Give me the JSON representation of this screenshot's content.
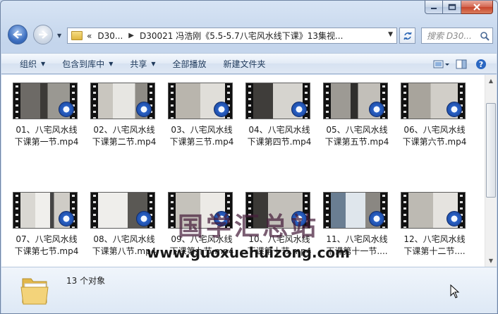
{
  "window": {
    "accent": "#c4d5ec"
  },
  "address": {
    "chevron": "«",
    "crumbs": [
      "D30...",
      "D30021 冯浩刚《5.5-5.7八宅风水线下课》13集视..."
    ]
  },
  "search": {
    "placeholder": "搜索 D30..."
  },
  "toolbar": {
    "organize": "组织",
    "include_library": "包含到库中",
    "share": "共享",
    "play_all": "全部播放",
    "new_folder": "新建文件夹"
  },
  "files": [
    {
      "line1": "01、八宅风水线",
      "line2": "下课第一节.mp4"
    },
    {
      "line1": "02、八宅风水线",
      "line2": "下课第二节.mp4"
    },
    {
      "line1": "03、八宅风水线",
      "line2": "下课第三节.mp4"
    },
    {
      "line1": "04、八宅风水线",
      "line2": "下课第四节.mp4"
    },
    {
      "line1": "05、八宅风水线",
      "line2": "下课第五节.mp4"
    },
    {
      "line1": "06、八宅风水线",
      "line2": "下课第六节.mp4"
    },
    {
      "line1": "07、八宅风水线",
      "line2": "下课第七节.mp4"
    },
    {
      "line1": "08、八宅风水线",
      "line2": "下课第八节.mp4"
    },
    {
      "line1": "09、八宅风水线",
      "line2": "下课第九节.mp4"
    },
    {
      "line1": "10、八宅风水线",
      "line2": "下课第十节.mp4"
    },
    {
      "line1": "11、八宅风水线",
      "line2": "下课第十一节...."
    },
    {
      "line1": "12、八宅风水线",
      "line2": "下课第十二节...."
    }
  ],
  "status": {
    "count_text": "13 个对象"
  },
  "watermark": {
    "title": "国学汇总站",
    "url": "www.guoxuehuizong.com"
  },
  "icons": [
    "minimize-icon",
    "maximize-icon",
    "close-icon",
    "back-arrow-icon",
    "forward-arrow-icon",
    "folder-icon",
    "refresh-icon",
    "search-icon",
    "view-options-icon",
    "preview-pane-icon",
    "help-icon",
    "media-player-icon",
    "cursor-icon"
  ]
}
